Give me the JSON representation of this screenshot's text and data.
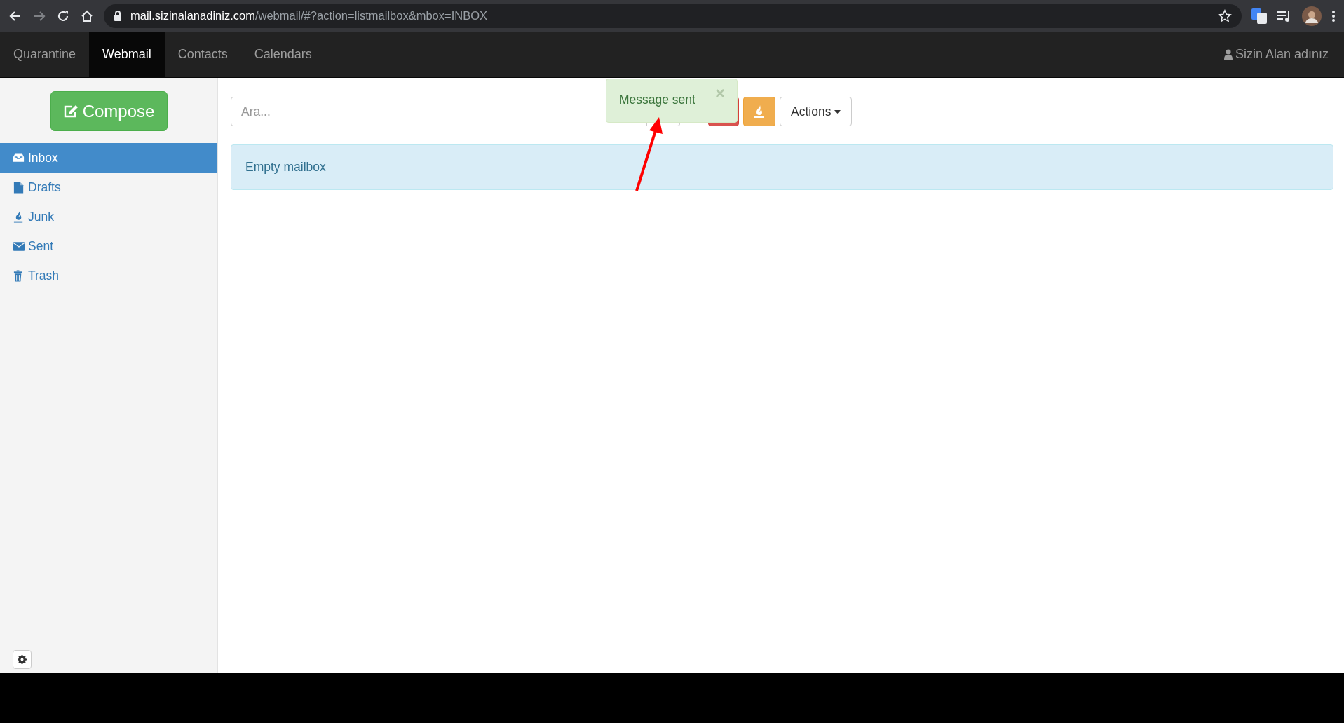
{
  "browser": {
    "url_host": "mail.sizinalanadiniz.com",
    "url_path": "/webmail/#?action=listmailbox&mbox=INBOX"
  },
  "nav": {
    "tabs": [
      {
        "label": "Quarantine",
        "selected": false
      },
      {
        "label": "Webmail",
        "selected": true
      },
      {
        "label": "Contacts",
        "selected": false
      },
      {
        "label": "Calendars",
        "selected": false
      }
    ],
    "user": "Sizin Alan adınız"
  },
  "sidebar": {
    "compose": "Compose",
    "folders": [
      {
        "kind": "inbox",
        "label": "Inbox",
        "selected": true
      },
      {
        "kind": "drafts",
        "label": "Drafts",
        "selected": false
      },
      {
        "kind": "junk",
        "label": "Junk",
        "selected": false
      },
      {
        "kind": "sent",
        "label": "Sent",
        "selected": false
      },
      {
        "kind": "trash",
        "label": "Trash",
        "selected": false
      }
    ]
  },
  "toolbar": {
    "search": {
      "placeholder": "Ara..."
    },
    "actions": "Actions"
  },
  "toast": {
    "text": "Message sent",
    "close": "×"
  },
  "alert": "Empty mailbox"
}
